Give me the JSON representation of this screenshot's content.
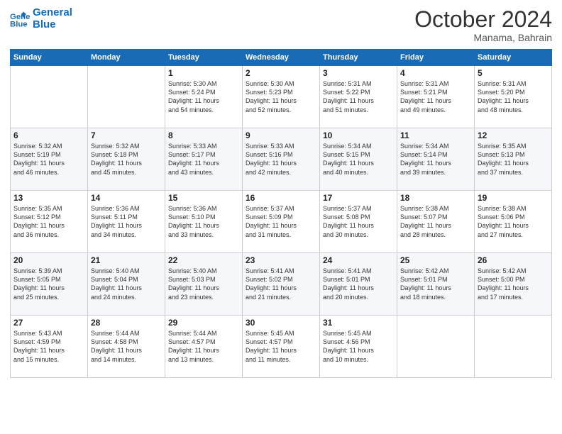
{
  "logo": {
    "line1": "General",
    "line2": "Blue"
  },
  "title": "October 2024",
  "subtitle": "Manama, Bahrain",
  "weekdays": [
    "Sunday",
    "Monday",
    "Tuesday",
    "Wednesday",
    "Thursday",
    "Friday",
    "Saturday"
  ],
  "weeks": [
    [
      {
        "day": "",
        "info": ""
      },
      {
        "day": "",
        "info": ""
      },
      {
        "day": "1",
        "info": "Sunrise: 5:30 AM\nSunset: 5:24 PM\nDaylight: 11 hours\nand 54 minutes."
      },
      {
        "day": "2",
        "info": "Sunrise: 5:30 AM\nSunset: 5:23 PM\nDaylight: 11 hours\nand 52 minutes."
      },
      {
        "day": "3",
        "info": "Sunrise: 5:31 AM\nSunset: 5:22 PM\nDaylight: 11 hours\nand 51 minutes."
      },
      {
        "day": "4",
        "info": "Sunrise: 5:31 AM\nSunset: 5:21 PM\nDaylight: 11 hours\nand 49 minutes."
      },
      {
        "day": "5",
        "info": "Sunrise: 5:31 AM\nSunset: 5:20 PM\nDaylight: 11 hours\nand 48 minutes."
      }
    ],
    [
      {
        "day": "6",
        "info": "Sunrise: 5:32 AM\nSunset: 5:19 PM\nDaylight: 11 hours\nand 46 minutes."
      },
      {
        "day": "7",
        "info": "Sunrise: 5:32 AM\nSunset: 5:18 PM\nDaylight: 11 hours\nand 45 minutes."
      },
      {
        "day": "8",
        "info": "Sunrise: 5:33 AM\nSunset: 5:17 PM\nDaylight: 11 hours\nand 43 minutes."
      },
      {
        "day": "9",
        "info": "Sunrise: 5:33 AM\nSunset: 5:16 PM\nDaylight: 11 hours\nand 42 minutes."
      },
      {
        "day": "10",
        "info": "Sunrise: 5:34 AM\nSunset: 5:15 PM\nDaylight: 11 hours\nand 40 minutes."
      },
      {
        "day": "11",
        "info": "Sunrise: 5:34 AM\nSunset: 5:14 PM\nDaylight: 11 hours\nand 39 minutes."
      },
      {
        "day": "12",
        "info": "Sunrise: 5:35 AM\nSunset: 5:13 PM\nDaylight: 11 hours\nand 37 minutes."
      }
    ],
    [
      {
        "day": "13",
        "info": "Sunrise: 5:35 AM\nSunset: 5:12 PM\nDaylight: 11 hours\nand 36 minutes."
      },
      {
        "day": "14",
        "info": "Sunrise: 5:36 AM\nSunset: 5:11 PM\nDaylight: 11 hours\nand 34 minutes."
      },
      {
        "day": "15",
        "info": "Sunrise: 5:36 AM\nSunset: 5:10 PM\nDaylight: 11 hours\nand 33 minutes."
      },
      {
        "day": "16",
        "info": "Sunrise: 5:37 AM\nSunset: 5:09 PM\nDaylight: 11 hours\nand 31 minutes."
      },
      {
        "day": "17",
        "info": "Sunrise: 5:37 AM\nSunset: 5:08 PM\nDaylight: 11 hours\nand 30 minutes."
      },
      {
        "day": "18",
        "info": "Sunrise: 5:38 AM\nSunset: 5:07 PM\nDaylight: 11 hours\nand 28 minutes."
      },
      {
        "day": "19",
        "info": "Sunrise: 5:38 AM\nSunset: 5:06 PM\nDaylight: 11 hours\nand 27 minutes."
      }
    ],
    [
      {
        "day": "20",
        "info": "Sunrise: 5:39 AM\nSunset: 5:05 PM\nDaylight: 11 hours\nand 25 minutes."
      },
      {
        "day": "21",
        "info": "Sunrise: 5:40 AM\nSunset: 5:04 PM\nDaylight: 11 hours\nand 24 minutes."
      },
      {
        "day": "22",
        "info": "Sunrise: 5:40 AM\nSunset: 5:03 PM\nDaylight: 11 hours\nand 23 minutes."
      },
      {
        "day": "23",
        "info": "Sunrise: 5:41 AM\nSunset: 5:02 PM\nDaylight: 11 hours\nand 21 minutes."
      },
      {
        "day": "24",
        "info": "Sunrise: 5:41 AM\nSunset: 5:01 PM\nDaylight: 11 hours\nand 20 minutes."
      },
      {
        "day": "25",
        "info": "Sunrise: 5:42 AM\nSunset: 5:01 PM\nDaylight: 11 hours\nand 18 minutes."
      },
      {
        "day": "26",
        "info": "Sunrise: 5:42 AM\nSunset: 5:00 PM\nDaylight: 11 hours\nand 17 minutes."
      }
    ],
    [
      {
        "day": "27",
        "info": "Sunrise: 5:43 AM\nSunset: 4:59 PM\nDaylight: 11 hours\nand 15 minutes."
      },
      {
        "day": "28",
        "info": "Sunrise: 5:44 AM\nSunset: 4:58 PM\nDaylight: 11 hours\nand 14 minutes."
      },
      {
        "day": "29",
        "info": "Sunrise: 5:44 AM\nSunset: 4:57 PM\nDaylight: 11 hours\nand 13 minutes."
      },
      {
        "day": "30",
        "info": "Sunrise: 5:45 AM\nSunset: 4:57 PM\nDaylight: 11 hours\nand 11 minutes."
      },
      {
        "day": "31",
        "info": "Sunrise: 5:45 AM\nSunset: 4:56 PM\nDaylight: 11 hours\nand 10 minutes."
      },
      {
        "day": "",
        "info": ""
      },
      {
        "day": "",
        "info": ""
      }
    ]
  ]
}
